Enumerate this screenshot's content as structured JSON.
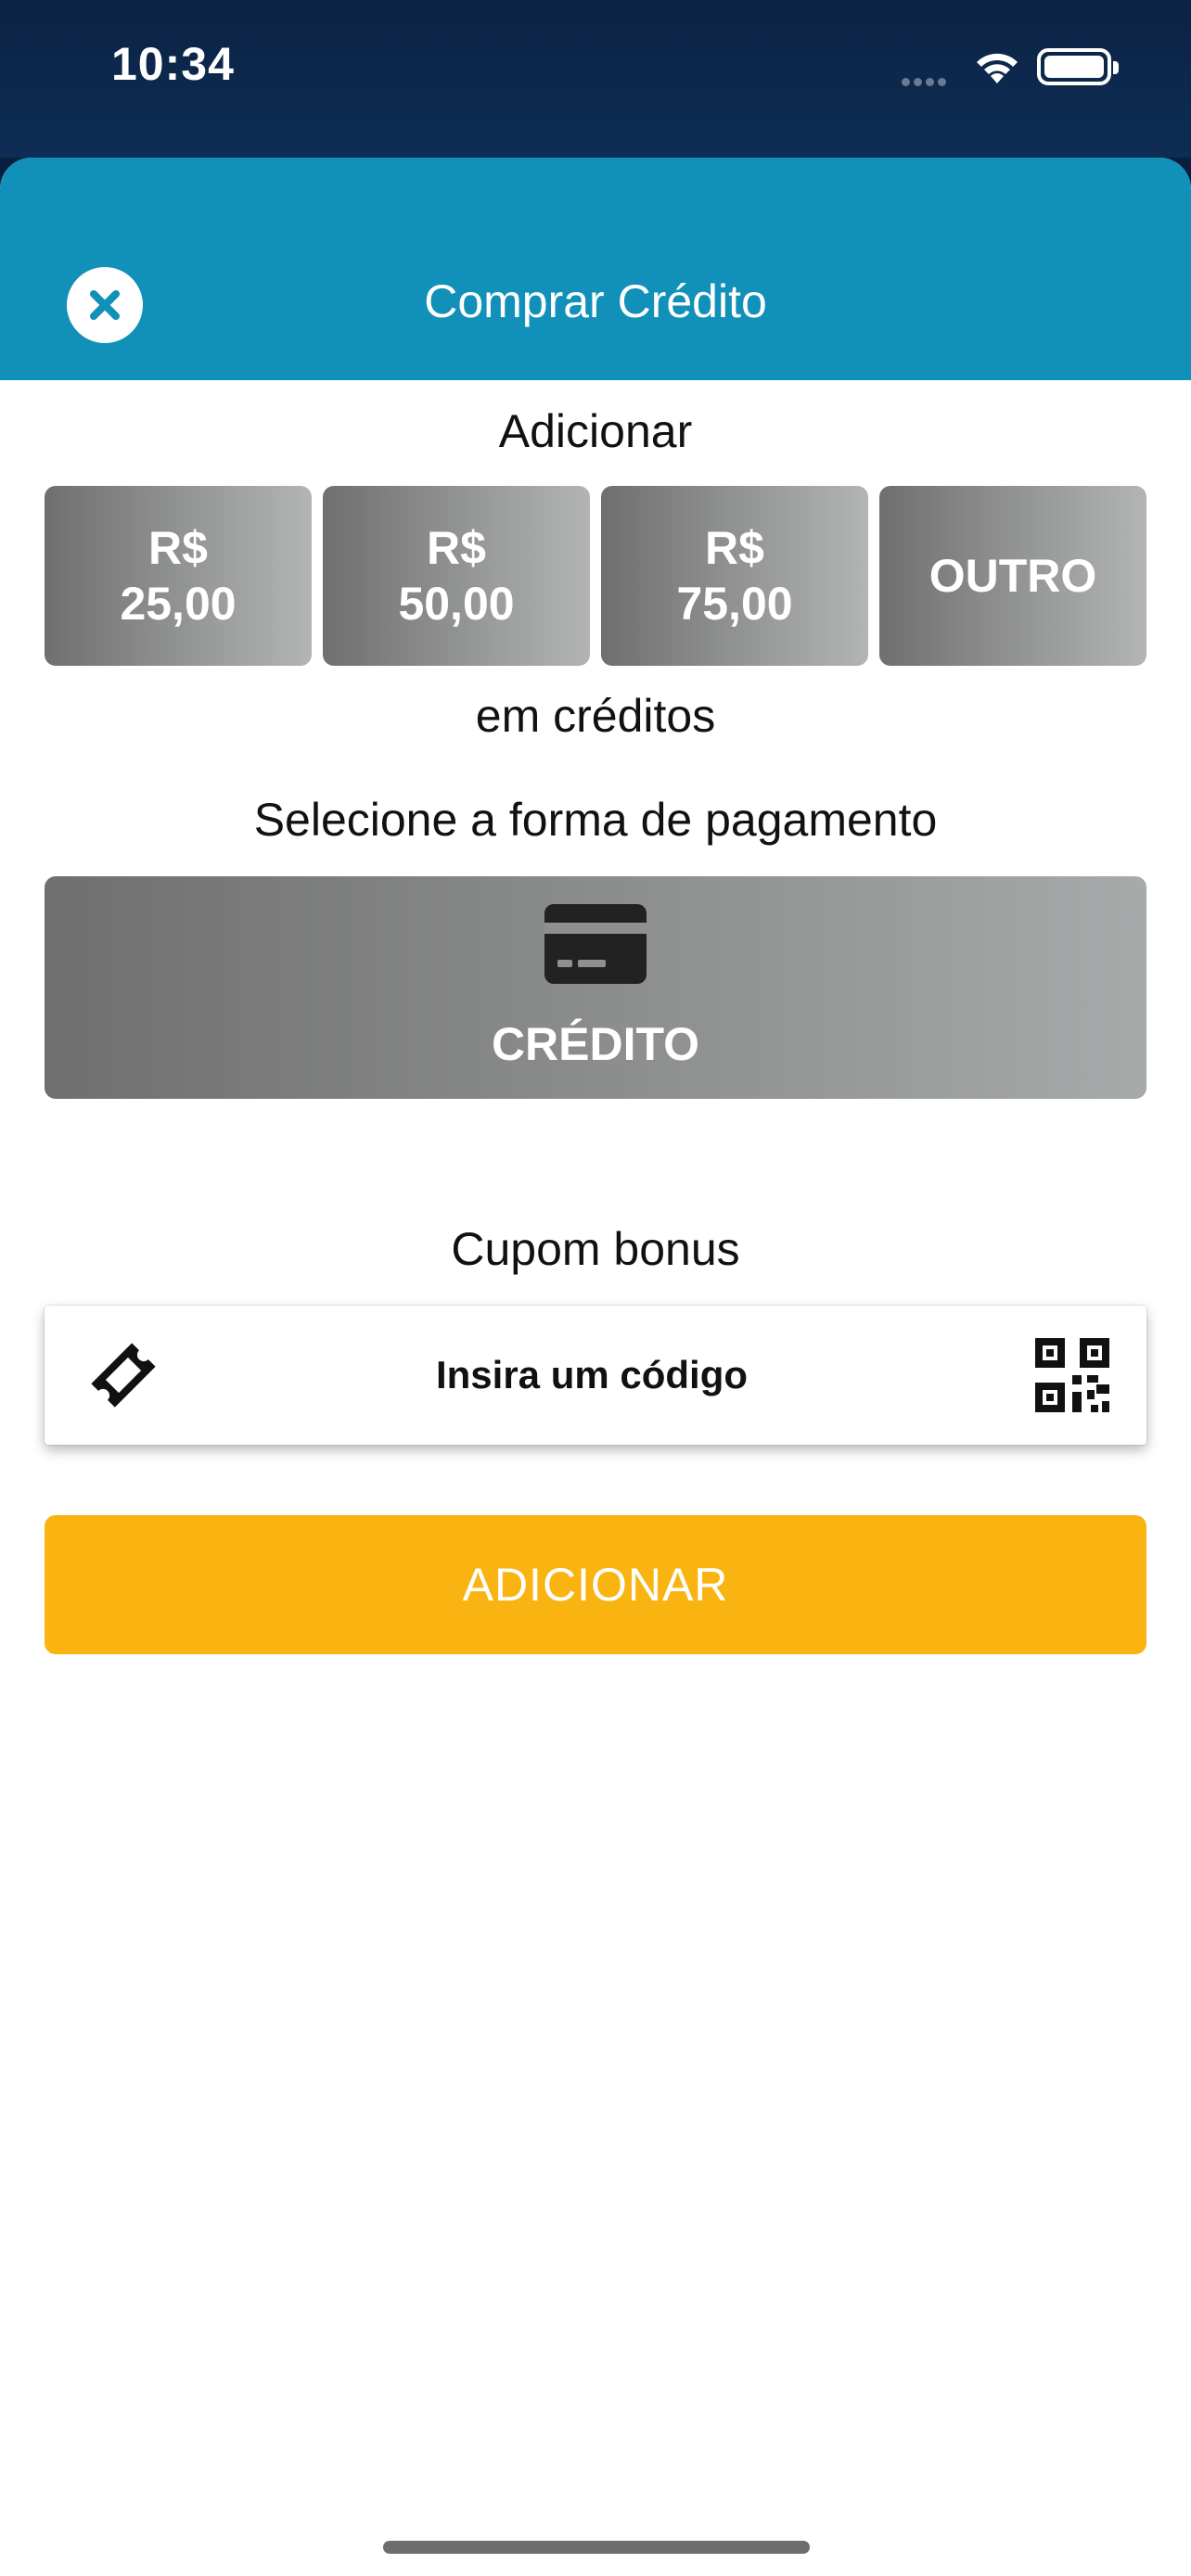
{
  "status_bar": {
    "time": "10:34"
  },
  "header": {
    "title": "Comprar Crédito",
    "close_icon": "close-icon"
  },
  "add_section": {
    "label": "Adicionar",
    "amounts": [
      {
        "prefix": "R$",
        "value": "25,00"
      },
      {
        "prefix": "R$",
        "value": "50,00"
      },
      {
        "prefix": "R$",
        "value": "75,00"
      },
      {
        "prefix": "",
        "value": "OUTRO"
      }
    ],
    "suffix_label": "em créditos"
  },
  "payment": {
    "label": "Selecione a forma de pagamento",
    "option_label": "CRÉDITO",
    "option_icon": "credit-card-icon"
  },
  "coupon": {
    "label": "Cupom bonus",
    "placeholder": "Insira um código",
    "left_icon": "ticket-icon",
    "right_icon": "qr-code-icon"
  },
  "submit": {
    "label": "ADICIONAR"
  },
  "colors": {
    "header": "#1190b9",
    "accent_button": "#f9b411",
    "gray_button_start": "#6f6f6f",
    "gray_button_end": "#b3b5b5"
  }
}
